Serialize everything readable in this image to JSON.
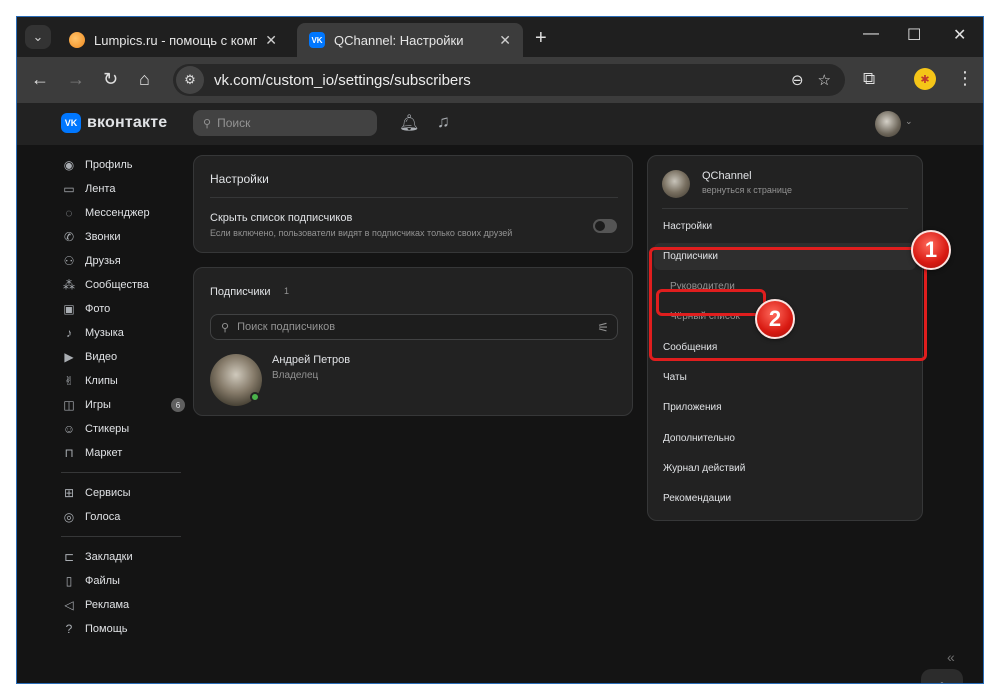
{
  "browser": {
    "tabs": [
      {
        "title": "Lumpics.ru - помощь с компьютером",
        "active": false
      },
      {
        "title": "QChannel: Настройки",
        "active": true
      }
    ],
    "url": "vk.com/custom_io/settings/subscribers"
  },
  "vk": {
    "logo_text": "вконтакте",
    "search_placeholder": "Поиск"
  },
  "left_nav": {
    "items": [
      {
        "label": "Профиль",
        "icon": "user-icon"
      },
      {
        "label": "Лента",
        "icon": "feed-icon"
      },
      {
        "label": "Мессенджер",
        "icon": "chat-icon"
      },
      {
        "label": "Звонки",
        "icon": "phone-icon"
      },
      {
        "label": "Друзья",
        "icon": "friends-icon"
      },
      {
        "label": "Сообщества",
        "icon": "groups-icon"
      },
      {
        "label": "Фото",
        "icon": "photo-icon"
      },
      {
        "label": "Музыка",
        "icon": "music-icon"
      },
      {
        "label": "Видео",
        "icon": "video-icon"
      },
      {
        "label": "Клипы",
        "icon": "clips-icon"
      },
      {
        "label": "Игры",
        "icon": "gamepad-icon",
        "badge": "6"
      },
      {
        "label": "Стикеры",
        "icon": "sticker-icon"
      },
      {
        "label": "Маркет",
        "icon": "market-icon"
      }
    ],
    "group2": [
      {
        "label": "Сервисы",
        "icon": "services-icon"
      },
      {
        "label": "Голоса",
        "icon": "votes-icon"
      }
    ],
    "group3": [
      {
        "label": "Закладки",
        "icon": "bookmark-icon"
      },
      {
        "label": "Файлы",
        "icon": "file-icon"
      },
      {
        "label": "Реклама",
        "icon": "megaphone-icon"
      },
      {
        "label": "Помощь",
        "icon": "help-icon"
      }
    ]
  },
  "settings_card": {
    "title": "Настройки",
    "option_title": "Скрыть список подписчиков",
    "option_desc": "Если включено, пользователи видят в подписчиках только своих друзей",
    "option_enabled": false
  },
  "subscribers_card": {
    "title": "Подписчики",
    "count": "1",
    "search_placeholder": "Поиск подписчиков",
    "items": [
      {
        "name": "Андрей Петров",
        "role": "Владелец"
      }
    ]
  },
  "right_menu": {
    "community_name": "QChannel",
    "back_link": "вернуться к странице",
    "items": [
      "Настройки",
      "Подписчики",
      "Сообщения",
      "Чаты",
      "Приложения",
      "Дополнительно",
      "Журнал действий",
      "Рекомендации"
    ],
    "selected": "Подписчики",
    "sub_items": [
      "Руководители",
      "Чёрный список"
    ]
  },
  "annotations": [
    "1",
    "2"
  ],
  "colors": {
    "accent": "#0077ff",
    "annotation": "#e01e1e",
    "online": "#4bb34b"
  }
}
